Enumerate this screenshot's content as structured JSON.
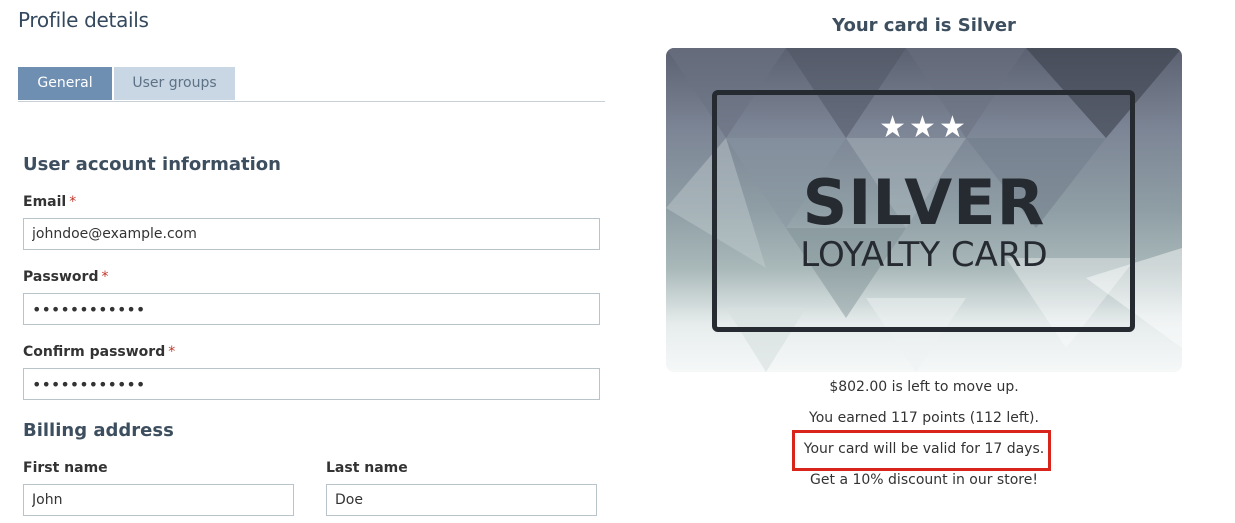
{
  "page_title": "Profile details",
  "tabs": [
    {
      "label": "General",
      "active": true
    },
    {
      "label": "User groups",
      "active": false
    }
  ],
  "account": {
    "section_title": "User account information",
    "email_label": "Email",
    "email_value": "johndoe@example.com",
    "password_label": "Password",
    "password_value": "••••••••••••",
    "confirm_label": "Confirm password",
    "confirm_value": "••••••••••••",
    "required_mark": "*"
  },
  "billing": {
    "section_title": "Billing address",
    "first_name_label": "First name",
    "first_name_value": "John",
    "last_name_label": "Last name",
    "last_name_value": "Doe"
  },
  "card": {
    "heading": "Your card is Silver",
    "stars": "★★★",
    "big_text": "SILVER",
    "sub_text": "LOYALTY CARD"
  },
  "card_info": {
    "move_up": "$802.00 is left to move up.",
    "points": "You earned 117 points (112 left).",
    "validity": "Your card will be valid for 17 days.",
    "discount": "Get a 10% discount in our store!"
  },
  "colors": {
    "highlight": "#d9241c",
    "tab_active": "#6e8eb2",
    "tab_inactive": "#c9d6e3"
  }
}
